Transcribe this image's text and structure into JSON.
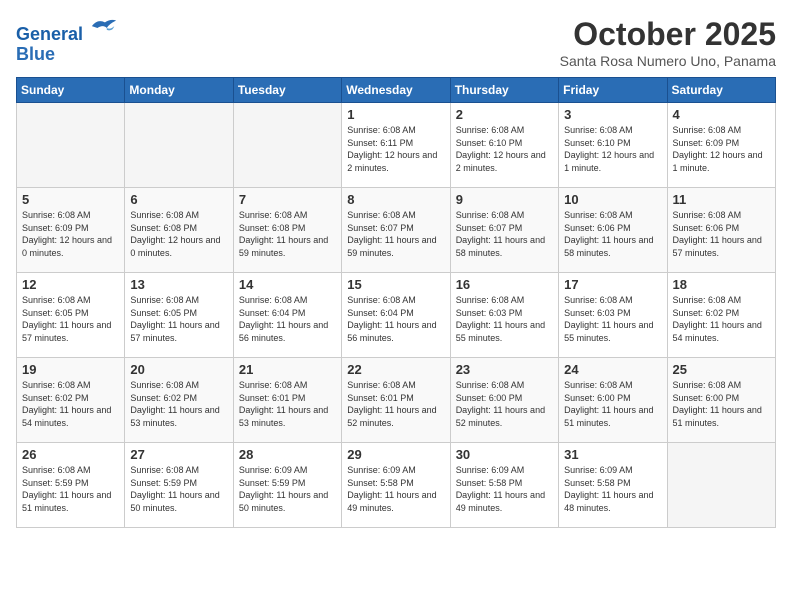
{
  "header": {
    "logo_line1": "General",
    "logo_line2": "Blue",
    "month": "October 2025",
    "location": "Santa Rosa Numero Uno, Panama"
  },
  "days_of_week": [
    "Sunday",
    "Monday",
    "Tuesday",
    "Wednesday",
    "Thursday",
    "Friday",
    "Saturday"
  ],
  "weeks": [
    [
      {
        "day": "",
        "info": ""
      },
      {
        "day": "",
        "info": ""
      },
      {
        "day": "",
        "info": ""
      },
      {
        "day": "1",
        "info": "Sunrise: 6:08 AM\nSunset: 6:11 PM\nDaylight: 12 hours and 2 minutes."
      },
      {
        "day": "2",
        "info": "Sunrise: 6:08 AM\nSunset: 6:10 PM\nDaylight: 12 hours and 2 minutes."
      },
      {
        "day": "3",
        "info": "Sunrise: 6:08 AM\nSunset: 6:10 PM\nDaylight: 12 hours and 1 minute."
      },
      {
        "day": "4",
        "info": "Sunrise: 6:08 AM\nSunset: 6:09 PM\nDaylight: 12 hours and 1 minute."
      }
    ],
    [
      {
        "day": "5",
        "info": "Sunrise: 6:08 AM\nSunset: 6:09 PM\nDaylight: 12 hours and 0 minutes."
      },
      {
        "day": "6",
        "info": "Sunrise: 6:08 AM\nSunset: 6:08 PM\nDaylight: 12 hours and 0 minutes."
      },
      {
        "day": "7",
        "info": "Sunrise: 6:08 AM\nSunset: 6:08 PM\nDaylight: 11 hours and 59 minutes."
      },
      {
        "day": "8",
        "info": "Sunrise: 6:08 AM\nSunset: 6:07 PM\nDaylight: 11 hours and 59 minutes."
      },
      {
        "day": "9",
        "info": "Sunrise: 6:08 AM\nSunset: 6:07 PM\nDaylight: 11 hours and 58 minutes."
      },
      {
        "day": "10",
        "info": "Sunrise: 6:08 AM\nSunset: 6:06 PM\nDaylight: 11 hours and 58 minutes."
      },
      {
        "day": "11",
        "info": "Sunrise: 6:08 AM\nSunset: 6:06 PM\nDaylight: 11 hours and 57 minutes."
      }
    ],
    [
      {
        "day": "12",
        "info": "Sunrise: 6:08 AM\nSunset: 6:05 PM\nDaylight: 11 hours and 57 minutes."
      },
      {
        "day": "13",
        "info": "Sunrise: 6:08 AM\nSunset: 6:05 PM\nDaylight: 11 hours and 57 minutes."
      },
      {
        "day": "14",
        "info": "Sunrise: 6:08 AM\nSunset: 6:04 PM\nDaylight: 11 hours and 56 minutes."
      },
      {
        "day": "15",
        "info": "Sunrise: 6:08 AM\nSunset: 6:04 PM\nDaylight: 11 hours and 56 minutes."
      },
      {
        "day": "16",
        "info": "Sunrise: 6:08 AM\nSunset: 6:03 PM\nDaylight: 11 hours and 55 minutes."
      },
      {
        "day": "17",
        "info": "Sunrise: 6:08 AM\nSunset: 6:03 PM\nDaylight: 11 hours and 55 minutes."
      },
      {
        "day": "18",
        "info": "Sunrise: 6:08 AM\nSunset: 6:02 PM\nDaylight: 11 hours and 54 minutes."
      }
    ],
    [
      {
        "day": "19",
        "info": "Sunrise: 6:08 AM\nSunset: 6:02 PM\nDaylight: 11 hours and 54 minutes."
      },
      {
        "day": "20",
        "info": "Sunrise: 6:08 AM\nSunset: 6:02 PM\nDaylight: 11 hours and 53 minutes."
      },
      {
        "day": "21",
        "info": "Sunrise: 6:08 AM\nSunset: 6:01 PM\nDaylight: 11 hours and 53 minutes."
      },
      {
        "day": "22",
        "info": "Sunrise: 6:08 AM\nSunset: 6:01 PM\nDaylight: 11 hours and 52 minutes."
      },
      {
        "day": "23",
        "info": "Sunrise: 6:08 AM\nSunset: 6:00 PM\nDaylight: 11 hours and 52 minutes."
      },
      {
        "day": "24",
        "info": "Sunrise: 6:08 AM\nSunset: 6:00 PM\nDaylight: 11 hours and 51 minutes."
      },
      {
        "day": "25",
        "info": "Sunrise: 6:08 AM\nSunset: 6:00 PM\nDaylight: 11 hours and 51 minutes."
      }
    ],
    [
      {
        "day": "26",
        "info": "Sunrise: 6:08 AM\nSunset: 5:59 PM\nDaylight: 11 hours and 51 minutes."
      },
      {
        "day": "27",
        "info": "Sunrise: 6:08 AM\nSunset: 5:59 PM\nDaylight: 11 hours and 50 minutes."
      },
      {
        "day": "28",
        "info": "Sunrise: 6:09 AM\nSunset: 5:59 PM\nDaylight: 11 hours and 50 minutes."
      },
      {
        "day": "29",
        "info": "Sunrise: 6:09 AM\nSunset: 5:58 PM\nDaylight: 11 hours and 49 minutes."
      },
      {
        "day": "30",
        "info": "Sunrise: 6:09 AM\nSunset: 5:58 PM\nDaylight: 11 hours and 49 minutes."
      },
      {
        "day": "31",
        "info": "Sunrise: 6:09 AM\nSunset: 5:58 PM\nDaylight: 11 hours and 48 minutes."
      },
      {
        "day": "",
        "info": ""
      }
    ]
  ]
}
